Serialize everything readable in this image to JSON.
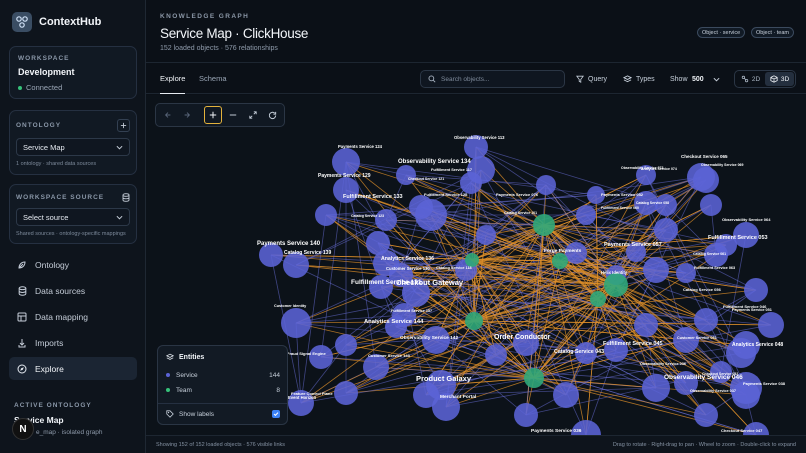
{
  "app": {
    "name": "ContextHub"
  },
  "workspace": {
    "label": "WORKSPACE",
    "name": "Development",
    "status": "Connected"
  },
  "ontology": {
    "label": "ONTOLOGY",
    "selected": "Service Map",
    "hint": "1 ontology · shared data sources"
  },
  "workspace_source": {
    "label": "WORKSPACE SOURCE",
    "selected": "Select source",
    "hint": "Shared sources · ontology-specific mappings"
  },
  "nav": [
    {
      "label": "Ontology",
      "icon": "ontology-icon"
    },
    {
      "label": "Data sources",
      "icon": "database-icon"
    },
    {
      "label": "Data mapping",
      "icon": "mapping-icon"
    },
    {
      "label": "Imports",
      "icon": "import-icon"
    },
    {
      "label": "Explore",
      "icon": "explore-icon",
      "active": true
    }
  ],
  "active_ontology": {
    "label": "ACTIVE ONTOLOGY",
    "name": "Service Map",
    "sub": "e_map · isolated graph"
  },
  "fab_letter": "N",
  "header": {
    "eyebrow": "KNOWLEDGE GRAPH",
    "title": "Service Map · ClickHouse",
    "subtitle": "152 loaded objects · 576 relationships",
    "badges": [
      "Object · service",
      "Object · team"
    ]
  },
  "tabs": [
    "Explore",
    "Schema"
  ],
  "toolbar": {
    "search_placeholder": "Search objects...",
    "query": "Query",
    "types": "Types",
    "show_label": "Show",
    "show_value": "500",
    "view_2d": "2D",
    "view_3d": "3D"
  },
  "entities": {
    "title": "Entities",
    "items": [
      {
        "label": "Service",
        "count": "144",
        "color": "#5b63d6"
      },
      {
        "label": "Team",
        "count": "8",
        "color": "#36c27a"
      }
    ],
    "show_labels": "Show labels"
  },
  "footer": {
    "left": "Showing 152 of 152 loaded objects · 576 visible links",
    "right": "Drag to rotate · Right-drag to pan · Wheel to zoom · Double-click to expand"
  },
  "colors": {
    "service_node": "#5b63d6",
    "team_node": "#2fa77a",
    "link_service": "#6a6fd8",
    "link_team": "#e0902a"
  },
  "graph_labels": [
    "Observability Service 113",
    "Payments Service 124",
    "Observability Service 134",
    "Payments Service 129",
    "Checkout Service 121",
    "Fulfillment Service 117",
    "Fulfillment Service 133",
    "Fulfillment Service 128",
    "Catalog Service 123",
    "Payments Service 076",
    "Checkout Service 065",
    "Analytics Service 074",
    "Observability Service 073",
    "Observability Service 069",
    "Payments Service 052",
    "Catalog Service 101",
    "Fulfillment Service 060",
    "Catalog Service 058",
    "Catalog Service 061",
    "Observability Service 064",
    "Fulfillment Service 053",
    "Payments Service 140",
    "Catalog Service 139",
    "Payments Service 057",
    "Forge Payments",
    "Analytics Service 136",
    "Customer Service 130",
    "Catalog Service 118",
    "Checkout Gateway",
    "Fulfillment Service 131",
    "Helix Identity",
    "Fulfillment Service 063",
    "Customer Identity",
    "Fulfillment Service 157",
    "Analytics Service 144",
    "Observability Service 142",
    "Order Conductor",
    "Fulfillment Service 045",
    "Catalog Service 043",
    "Analytics Service 048",
    "Fraud Signal Engine",
    "Customer Service 143",
    "Observability Service 036",
    "Product Galaxy",
    "Observability Service 046",
    "Feature Control Plane",
    "Event Horizon",
    "Merchant Portal",
    "Payments Service 036",
    "Checkout Service 047",
    "Fulfillment Service 046",
    "Payments Service 038",
    "Checkout Service 052",
    "Customer Service 051",
    "Observability Service 037",
    "Catalog Service 056",
    "Payments Service 051"
  ]
}
